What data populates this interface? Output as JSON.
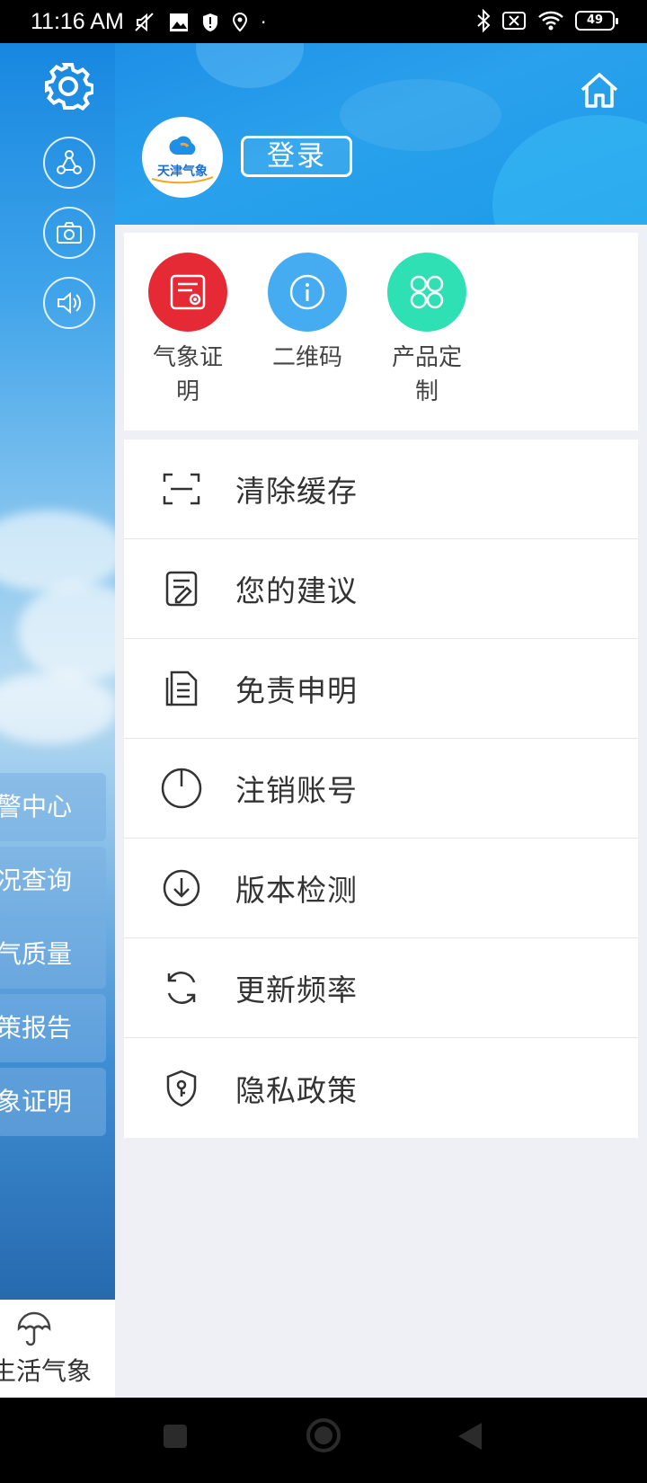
{
  "status_bar": {
    "time": "11:16 AM",
    "battery": "49"
  },
  "background_page": {
    "menu_items": [
      {
        "label": "警中心"
      },
      {
        "label": "况查询"
      },
      {
        "label": "气质量"
      },
      {
        "label": "策报告"
      },
      {
        "label": "象证明"
      }
    ],
    "bottom_tab_label": "生活气象"
  },
  "drawer": {
    "logo_text": "天津气象",
    "login_label": "登录",
    "quick_actions": [
      {
        "label": "气象证明",
        "color": "#e52a36",
        "icon": "certificate-icon"
      },
      {
        "label": "二维码",
        "color": "#45acf2",
        "icon": "info-icon"
      },
      {
        "label": "产品定制",
        "color": "#2fe0b4",
        "icon": "grid-icon"
      }
    ],
    "menu_items": [
      {
        "label": "清除缓存",
        "icon": "scan-frame-icon"
      },
      {
        "label": "您的建议",
        "icon": "edit-note-icon"
      },
      {
        "label": "免责申明",
        "icon": "document-icon"
      },
      {
        "label": "注销账号",
        "icon": "power-icon"
      },
      {
        "label": "版本检测",
        "icon": "download-circle-icon"
      },
      {
        "label": "更新频率",
        "icon": "refresh-icon"
      },
      {
        "label": "隐私政策",
        "icon": "shield-key-icon"
      }
    ]
  }
}
